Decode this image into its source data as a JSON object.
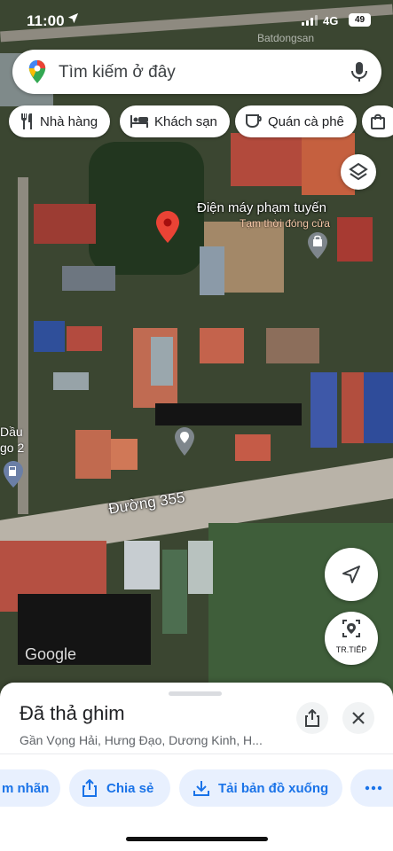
{
  "status_bar": {
    "time": "11:00",
    "location_arrow": "location-arrow-icon",
    "network": "4G",
    "battery": "49"
  },
  "watermark": "Batdongsan",
  "search": {
    "placeholder": "Tìm kiếm ở đây"
  },
  "chips": [
    {
      "label": "Nhà hàng",
      "icon": "restaurant-icon"
    },
    {
      "label": "Khách sạn",
      "icon": "hotel-icon"
    },
    {
      "label": "Quán cà phê",
      "icon": "coffee-icon"
    },
    {
      "label": "",
      "icon": "shopping-bag-icon"
    }
  ],
  "map": {
    "place_name": "Điện máy phạm tuyến",
    "place_status": "Tạm thời đóng cửa",
    "fuel_label": "Dầu\ngo 2",
    "road_name": "Đường 355",
    "logo": "Google",
    "live_button": "TR.TIẾP"
  },
  "sheet": {
    "title": "Đã thả ghim",
    "address": "Gần Vọng Hải, Hưng Đạo, Dương Kinh, H...",
    "actions": [
      {
        "label": "m nhãn",
        "icon": "label-icon"
      },
      {
        "label": "Chia sẻ",
        "icon": "share-icon"
      },
      {
        "label": "Tải bản đồ xuống",
        "icon": "download-icon"
      },
      {
        "label": "",
        "icon": "more-icon"
      }
    ]
  },
  "colors": {
    "accent": "#1a73e8",
    "pin_red": "#ea4335",
    "action_bg": "#e8f0fe"
  }
}
